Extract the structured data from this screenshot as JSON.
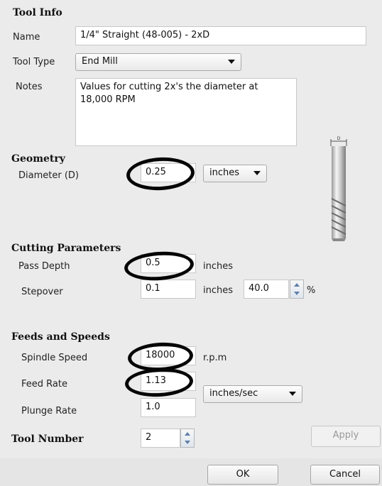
{
  "tool_info": {
    "title": "Tool Info",
    "name_label": "Name",
    "name_value": "1/4\" Straight (48-005) - 2xD",
    "tool_type_label": "Tool Type",
    "tool_type_value": "End Mill",
    "notes_label": "Notes",
    "notes_value": "Values for cutting 2x's the diameter at 18,000 RPM"
  },
  "geometry": {
    "title": "Geometry",
    "diameter_label": "Diameter (D)",
    "diameter_value": "0.25",
    "units_value": "inches",
    "tool_image_label": "D"
  },
  "cutting": {
    "title": "Cutting Parameters",
    "pass_depth_label": "Pass Depth",
    "pass_depth_value": "0.5",
    "pass_depth_units": "inches",
    "stepover_label": "Stepover",
    "stepover_value": "0.1",
    "stepover_units": "inches",
    "stepover_percent_value": "40.0",
    "percent_symbol": "%"
  },
  "feeds": {
    "title": "Feeds and Speeds",
    "spindle_label": "Spindle Speed",
    "spindle_value": "18000",
    "spindle_units": "r.p.m",
    "feed_rate_label": "Feed Rate",
    "feed_rate_value": "1.13",
    "feed_units_value": "inches/sec",
    "plunge_label": "Plunge Rate",
    "plunge_value": "1.0"
  },
  "tool_number": {
    "label": "Tool Number",
    "value": "2"
  },
  "buttons": {
    "apply": "Apply",
    "ok": "OK",
    "cancel": "Cancel"
  }
}
